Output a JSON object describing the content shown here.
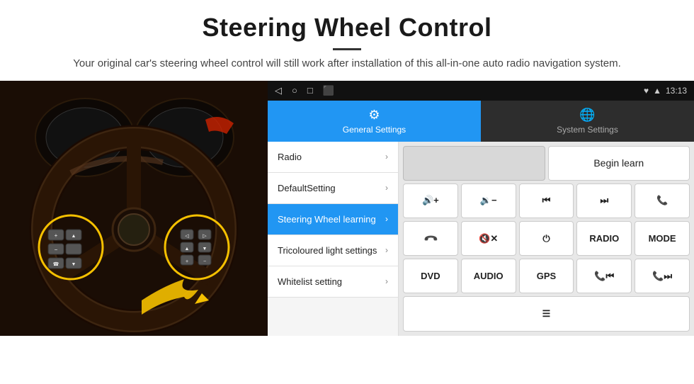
{
  "header": {
    "title": "Steering Wheel Control",
    "subtitle": "Your original car's steering wheel control will still work after installation of this all-in-one auto radio navigation system."
  },
  "status_bar": {
    "icons": [
      "◁",
      "○",
      "□",
      "⬛"
    ],
    "right_icons": "♥ ▲",
    "time": "13:13"
  },
  "tabs": [
    {
      "id": "general",
      "label": "General Settings",
      "active": true
    },
    {
      "id": "system",
      "label": "System Settings",
      "active": false
    }
  ],
  "menu_items": [
    {
      "id": "radio",
      "label": "Radio",
      "active": false
    },
    {
      "id": "default",
      "label": "DefaultSetting",
      "active": false
    },
    {
      "id": "steering",
      "label": "Steering Wheel learning",
      "active": true
    },
    {
      "id": "tricoloured",
      "label": "Tricoloured light settings",
      "active": false
    },
    {
      "id": "whitelist",
      "label": "Whitelist setting",
      "active": false
    }
  ],
  "controls": {
    "begin_learn": "Begin learn",
    "rows": [
      [
        "vol+",
        "vol-",
        "prev",
        "next",
        "phone"
      ],
      [
        "hangup",
        "mute",
        "power",
        "RADIO",
        "MODE"
      ],
      [
        "DVD",
        "AUDIO",
        "GPS",
        "prev-call",
        "next-call"
      ],
      [
        "menu-icon"
      ]
    ]
  },
  "icons": {
    "vol_up": "🔊+",
    "vol_down": "🔉-",
    "prev_track": "⏮",
    "next_track": "⏭",
    "phone": "📞",
    "hangup": "📞",
    "mute": "🔇",
    "power": "⏻",
    "radio_label": "RADIO",
    "mode_label": "MODE",
    "dvd_label": "DVD",
    "audio_label": "AUDIO",
    "gps_label": "GPS",
    "prev_call": "📞⏮",
    "next_call": "📞⏭",
    "menu": "☰",
    "general_settings_icon": "⚙",
    "system_settings_icon": "🌐",
    "chevron": "›"
  }
}
